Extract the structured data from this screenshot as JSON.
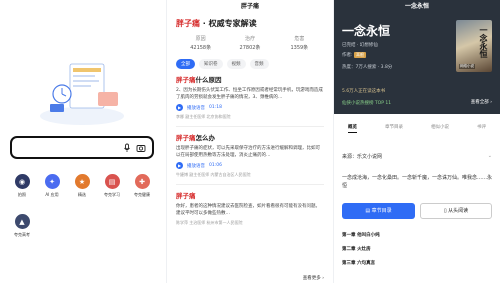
{
  "panel1": {
    "apps": [
      {
        "label": "拍照",
        "icon": "camera-icon",
        "color": "#2f3a66"
      },
      {
        "label": "AI 应用",
        "icon": "ai-icon",
        "color": "#4b6cf0"
      },
      {
        "label": "精选",
        "icon": "star-icon",
        "color": "#e27a2e"
      },
      {
        "label": "夸克学习",
        "icon": "book-icon",
        "color": "#d9534f"
      },
      {
        "label": "夸克健康",
        "icon": "health-icon",
        "color": "#e26a5a"
      },
      {
        "label": "夸克高考",
        "icon": "grad-icon",
        "color": "#3d4a6e"
      }
    ]
  },
  "panel2": {
    "top_title": "胖子痛",
    "header": {
      "keyword": "胖子痛",
      "suffix": "· 权威专家解读"
    },
    "stats": [
      {
        "label": "原因",
        "value": "42158条"
      },
      {
        "label": "治疗",
        "value": "27802条"
      },
      {
        "label": "危害",
        "value": "1359条"
      }
    ],
    "tabs": [
      "全部",
      "知识卷",
      "视频",
      "音频"
    ],
    "cards": [
      {
        "title_key": "胖子痛",
        "title_rest": "什么原因",
        "body": "2、因为长期伤头伏案工作、恒坐工作原因或者经常玩手机，玩游戏而造成了肌肉的劳损就会发生胖子痛的情况，3、颈椎病的…",
        "play": "播放语音",
        "time": "01:18",
        "meta": "李娜  副主任医师  北京协和医院"
      },
      {
        "title_key": "胖子痛",
        "title_rest": "怎么办",
        "body": "出现胖子痛的症状，可以先采取保守治疗的方法进行缓解和调理，比如可以在局部使用热敷等方法处理，消炎止痛药的…",
        "play": "播放语音",
        "time": "01:06",
        "meta": "牛婕博  副主任医师  内蒙古自治区人民医院"
      },
      {
        "title_key": "胖子痛",
        "title_rest": "",
        "body": "你好，患者的这种情况建议去医院检查，如片看看很有可能有没有问题。建议平时可以多做些热敷…",
        "play": "",
        "time": "",
        "meta": "陈学萍  主治医师  杭州市第一人民医院"
      }
    ],
    "see_more": "查看更多 ›"
  },
  "panel3": {
    "top_title": "一念永恒",
    "book_title": "一念永恒",
    "status": "已完结 · 幻想修仙",
    "author_label": "作者:",
    "author": "耳根",
    "heat": "热度：7万人搜索 · 3.8分",
    "cover_title": "一念永恒",
    "cover_sub": "网络小说",
    "recommend": "5.6万人正在读这本书",
    "rank": "仙侠小说热搜榜 TOP 11",
    "see_all": "查看全部 ›",
    "tabs": [
      "概览",
      "章节目录",
      "相似小说",
      "书评"
    ],
    "source": "来源：乐文小说网",
    "intro": "一念成沧海，一念化桑田。一念斩千魔，一念诛万仙。唯我念……永恒",
    "btn_catalog": "章节目录",
    "btn_read": "从头阅读",
    "chapters": [
      "第一章 他叫白小纯",
      "第二章 火灶房",
      "第三章 六句真言"
    ]
  }
}
